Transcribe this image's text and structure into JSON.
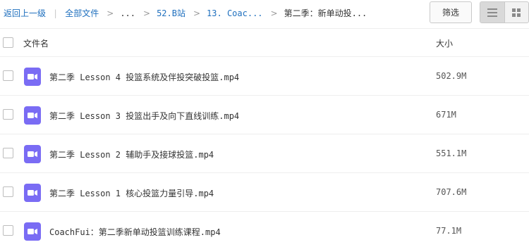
{
  "breadcrumb": {
    "back_label": "返回上一级",
    "all_files": "全部文件",
    "items": [
      "...",
      "52.B站",
      "13. Coac...",
      "第二季：新单动投..."
    ]
  },
  "toolbar": {
    "filter_label": "筛选",
    "view_icons": [
      "list-view-icon",
      "grid-view-icon"
    ]
  },
  "columns": {
    "name": "文件名",
    "size": "大小"
  },
  "files": [
    {
      "name": "第二季 Lesson 4 投篮系统及伴投突破投篮.mp4",
      "size": "502.9M",
      "icon": "video-file-icon"
    },
    {
      "name": "第二季 Lesson 3 投篮出手及向下直线训练.mp4",
      "size": "671M",
      "icon": "video-file-icon"
    },
    {
      "name": "第二季 Lesson 2 辅助手及接球投篮.mp4",
      "size": "551.1M",
      "icon": "video-file-icon"
    },
    {
      "name": "第二季 Lesson 1 核心投篮力量引导.mp4",
      "size": "707.6M",
      "icon": "video-file-icon"
    },
    {
      "name": "CoachFui：第二季新单动投篮训练课程.mp4",
      "size": "77.1M",
      "icon": "video-file-icon"
    }
  ],
  "colors": {
    "accent_link": "#1e6fbe",
    "video_icon": "#7a6cf4"
  }
}
